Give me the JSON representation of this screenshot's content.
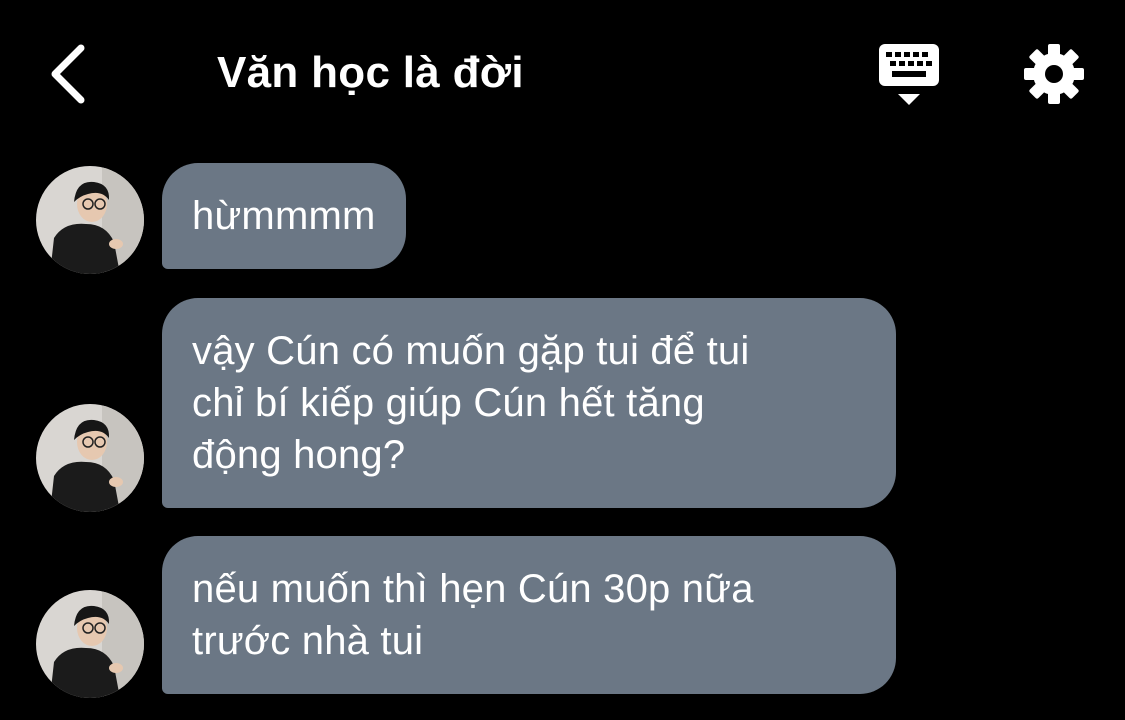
{
  "header": {
    "title": "Văn học là đời",
    "back_icon": "chevron-left-icon",
    "keyboard_icon": "keyboard-icon",
    "settings_icon": "gear-icon"
  },
  "messages": [
    {
      "lines": [
        "hừmmmm"
      ]
    },
    {
      "lines": [
        "vậy Cún có muốn gặp tui để tui",
        "chỉ bí kiếp giúp Cún hết tăng",
        "động hong?"
      ]
    },
    {
      "lines": [
        "nếu muốn thì hẹn Cún 30p nữa",
        "trước nhà tui"
      ]
    }
  ],
  "colors": {
    "background": "#000000",
    "bubble": "#6b7785",
    "text": "#ffffff"
  }
}
